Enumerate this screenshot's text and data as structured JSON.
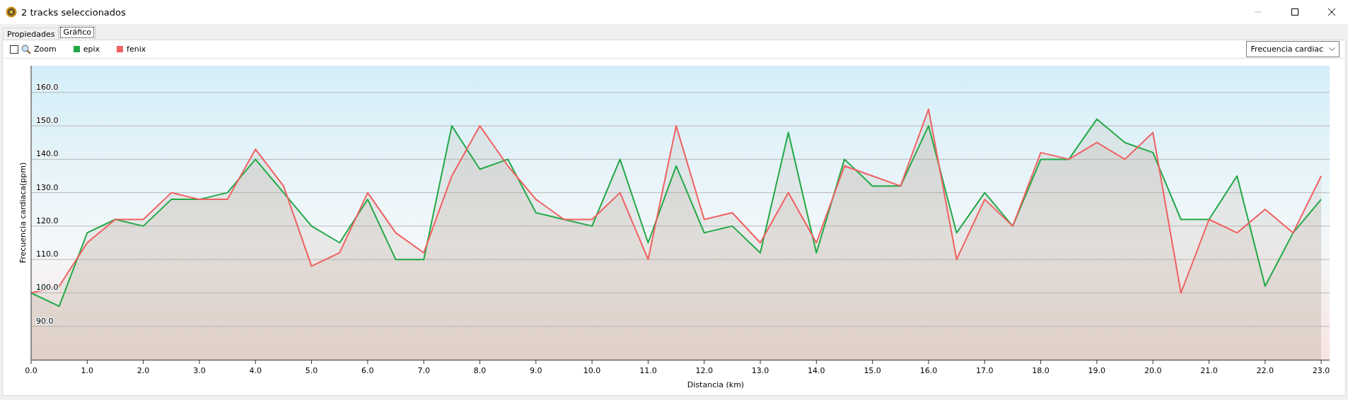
{
  "window": {
    "title": "2 tracks seleccionados"
  },
  "tabs": [
    {
      "label": "Propiedades",
      "selected": false
    },
    {
      "label": "Gráfico",
      "selected": true
    }
  ],
  "toolbar": {
    "zoom": {
      "label": "Zoom",
      "checked": false
    },
    "metric_select": {
      "value": "Frecuencia cardiac"
    }
  },
  "chart": {
    "chart_data": {
      "type": "area",
      "grid": true,
      "xlabel": "Distancia  (km)",
      "ylabel": "Frecuencia cardiaca(ppm)",
      "x": [
        0,
        0.5,
        1,
        1.5,
        2,
        2.5,
        3,
        3.5,
        4,
        4.5,
        5,
        5.5,
        6,
        6.5,
        7,
        7.5,
        8,
        8.5,
        9,
        9.5,
        10,
        10.5,
        11,
        11.5,
        12,
        12.5,
        13,
        13.5,
        14,
        14.5,
        15,
        15.5,
        16,
        16.5,
        17,
        17.5,
        18,
        18.5,
        19,
        19.5,
        20,
        20.5,
        21,
        21.5,
        22,
        22.5,
        23
      ],
      "series": [
        {
          "name": "epix",
          "color": "#22a846",
          "values": [
            100,
            96,
            118,
            122,
            120,
            128,
            128,
            130,
            140,
            130,
            120,
            115,
            128,
            110,
            110,
            150,
            137,
            140,
            124,
            122,
            120,
            140,
            115,
            138,
            118,
            120,
            112,
            148,
            112,
            140,
            132,
            132,
            150,
            118,
            130,
            120,
            140,
            140,
            152,
            145,
            142,
            122,
            122,
            135,
            102,
            118,
            128
          ]
        },
        {
          "name": "fenix",
          "color": "#f06060",
          "values": [
            100,
            102,
            115,
            122,
            122,
            130,
            128,
            128,
            143,
            132,
            108,
            112,
            130,
            118,
            112,
            135,
            150,
            138,
            128,
            122,
            122,
            130,
            110,
            150,
            122,
            124,
            115,
            130,
            115,
            138,
            135,
            132,
            155,
            110,
            128,
            120,
            142,
            140,
            145,
            140,
            148,
            100,
            122,
            118,
            125,
            118,
            135
          ]
        }
      ],
      "xlim": [
        0,
        23.15
      ],
      "ylim": [
        80,
        168
      ],
      "xticks": [
        {
          "value": 0,
          "label": "0.0"
        },
        {
          "value": 1,
          "label": "1.0"
        },
        {
          "value": 2,
          "label": "2.0"
        },
        {
          "value": 3,
          "label": "3.0"
        },
        {
          "value": 4,
          "label": "4.0"
        },
        {
          "value": 5,
          "label": "5.0"
        },
        {
          "value": 6,
          "label": "6.0"
        },
        {
          "value": 7,
          "label": "7.0"
        },
        {
          "value": 8,
          "label": "8.0"
        },
        {
          "value": 9,
          "label": "9.0"
        },
        {
          "value": 10,
          "label": "10.0"
        },
        {
          "value": 11,
          "label": "11.0"
        },
        {
          "value": 12,
          "label": "12.0"
        },
        {
          "value": 13,
          "label": "13.0"
        },
        {
          "value": 14,
          "label": "14.0"
        },
        {
          "value": 15,
          "label": "15.0"
        },
        {
          "value": 16,
          "label": "16.0"
        },
        {
          "value": 17,
          "label": "17.0"
        },
        {
          "value": 18,
          "label": "18.0"
        },
        {
          "value": 19,
          "label": "19.0"
        },
        {
          "value": 20,
          "label": "20.0"
        },
        {
          "value": 21,
          "label": "21.0"
        },
        {
          "value": 22,
          "label": "22.0"
        },
        {
          "value": 23,
          "label": "23.0"
        }
      ],
      "yticks": [
        {
          "value": 90,
          "label": "90.0"
        },
        {
          "value": 100,
          "label": "100.0"
        },
        {
          "value": 110,
          "label": "110.0"
        },
        {
          "value": 120,
          "label": "120.0"
        },
        {
          "value": 130,
          "label": "130.0"
        },
        {
          "value": 140,
          "label": "140.0"
        },
        {
          "value": 150,
          "label": "150.0"
        },
        {
          "value": 160,
          "label": "160.0"
        }
      ]
    }
  }
}
